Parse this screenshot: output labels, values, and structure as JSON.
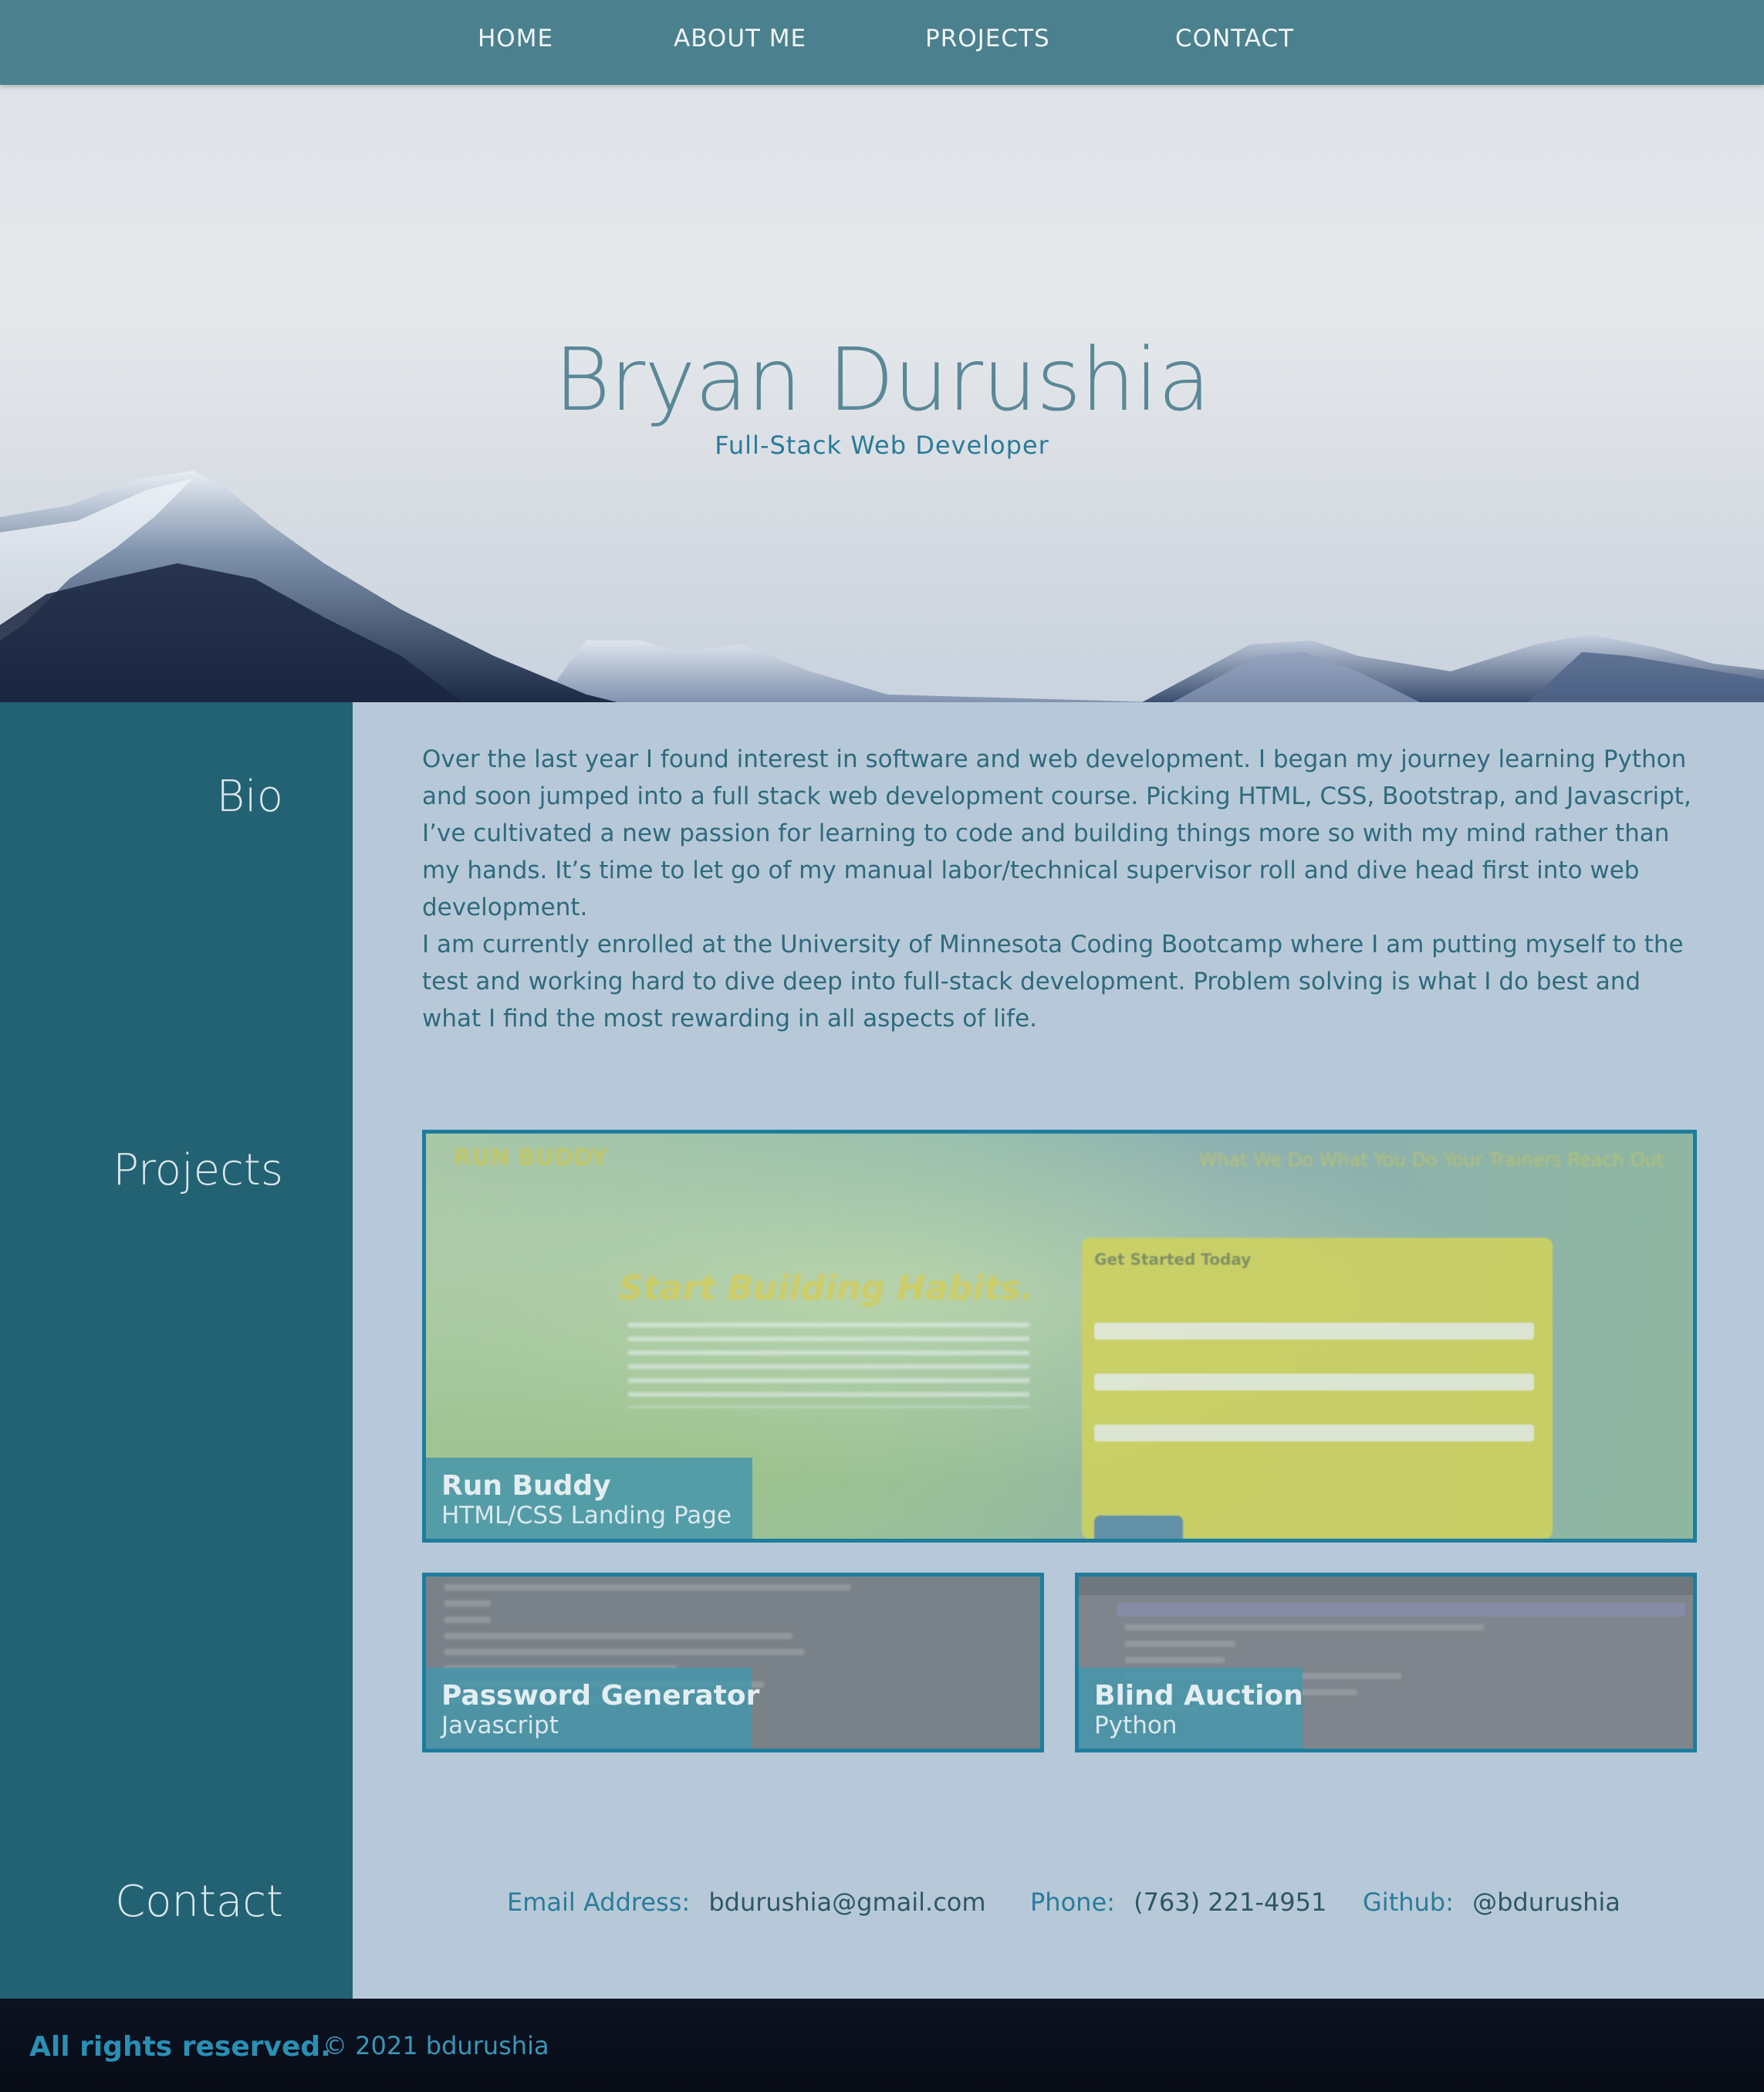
{
  "nav": {
    "items": [
      "HOME",
      "ABOUT ME",
      "PROJECTS",
      "CONTACT"
    ]
  },
  "hero": {
    "title": "Bryan Durushia",
    "subtitle": "Full-Stack Web Developer"
  },
  "sections": {
    "bio": "Bio",
    "projects": "Projects",
    "contact": "Contact"
  },
  "bio": {
    "paragraphs": [
      "Over the last year I found interest in software and web development. I began my journey learning Python and soon jumped into a full stack web development course. Picking HTML, CSS, Bootstrap, and Javascript, I’ve cultivated a new passion for learning to code and building things more so with my mind rather than my hands. It’s time to let go of my manual labor/technical supervisor roll and dive head first into web development.",
      "I am currently enrolled at the University of Minnesota Coding Bootcamp where I am putting myself to the test and working hard to dive deep into full-stack development. Problem solving is what I do best and what I find the most rewarding in all aspects of life."
    ]
  },
  "projects": [
    {
      "name": "Run Buddy",
      "tech": "HTML/CSS Landing Page",
      "preview": {
        "logo": "RUN BUDDY",
        "nav": "What We Do   What You Do   Your Trainers   Reach Out",
        "headline": "Start Building Habits.",
        "form_title": "Get Started Today"
      }
    },
    {
      "name": "Password Generator",
      "tech": "Javascript"
    },
    {
      "name": "Blind Auction",
      "tech": "Python"
    }
  ],
  "contact": {
    "email_label": "Email Address:",
    "email": "bdurushia@gmail.com",
    "phone_label": "Phone:",
    "phone": "(763) 221-4951",
    "github_label": "Github:",
    "github": "@bdurushia"
  },
  "footer": {
    "rights": "All rights reserved.",
    "copyright": "© 2021 bdurushia"
  },
  "colors": {
    "nav": "#4b808e",
    "sidebar": "#236273",
    "content_bg": "#b7c9d8",
    "accent": "#1e7d9d",
    "footer": "#070b16"
  }
}
